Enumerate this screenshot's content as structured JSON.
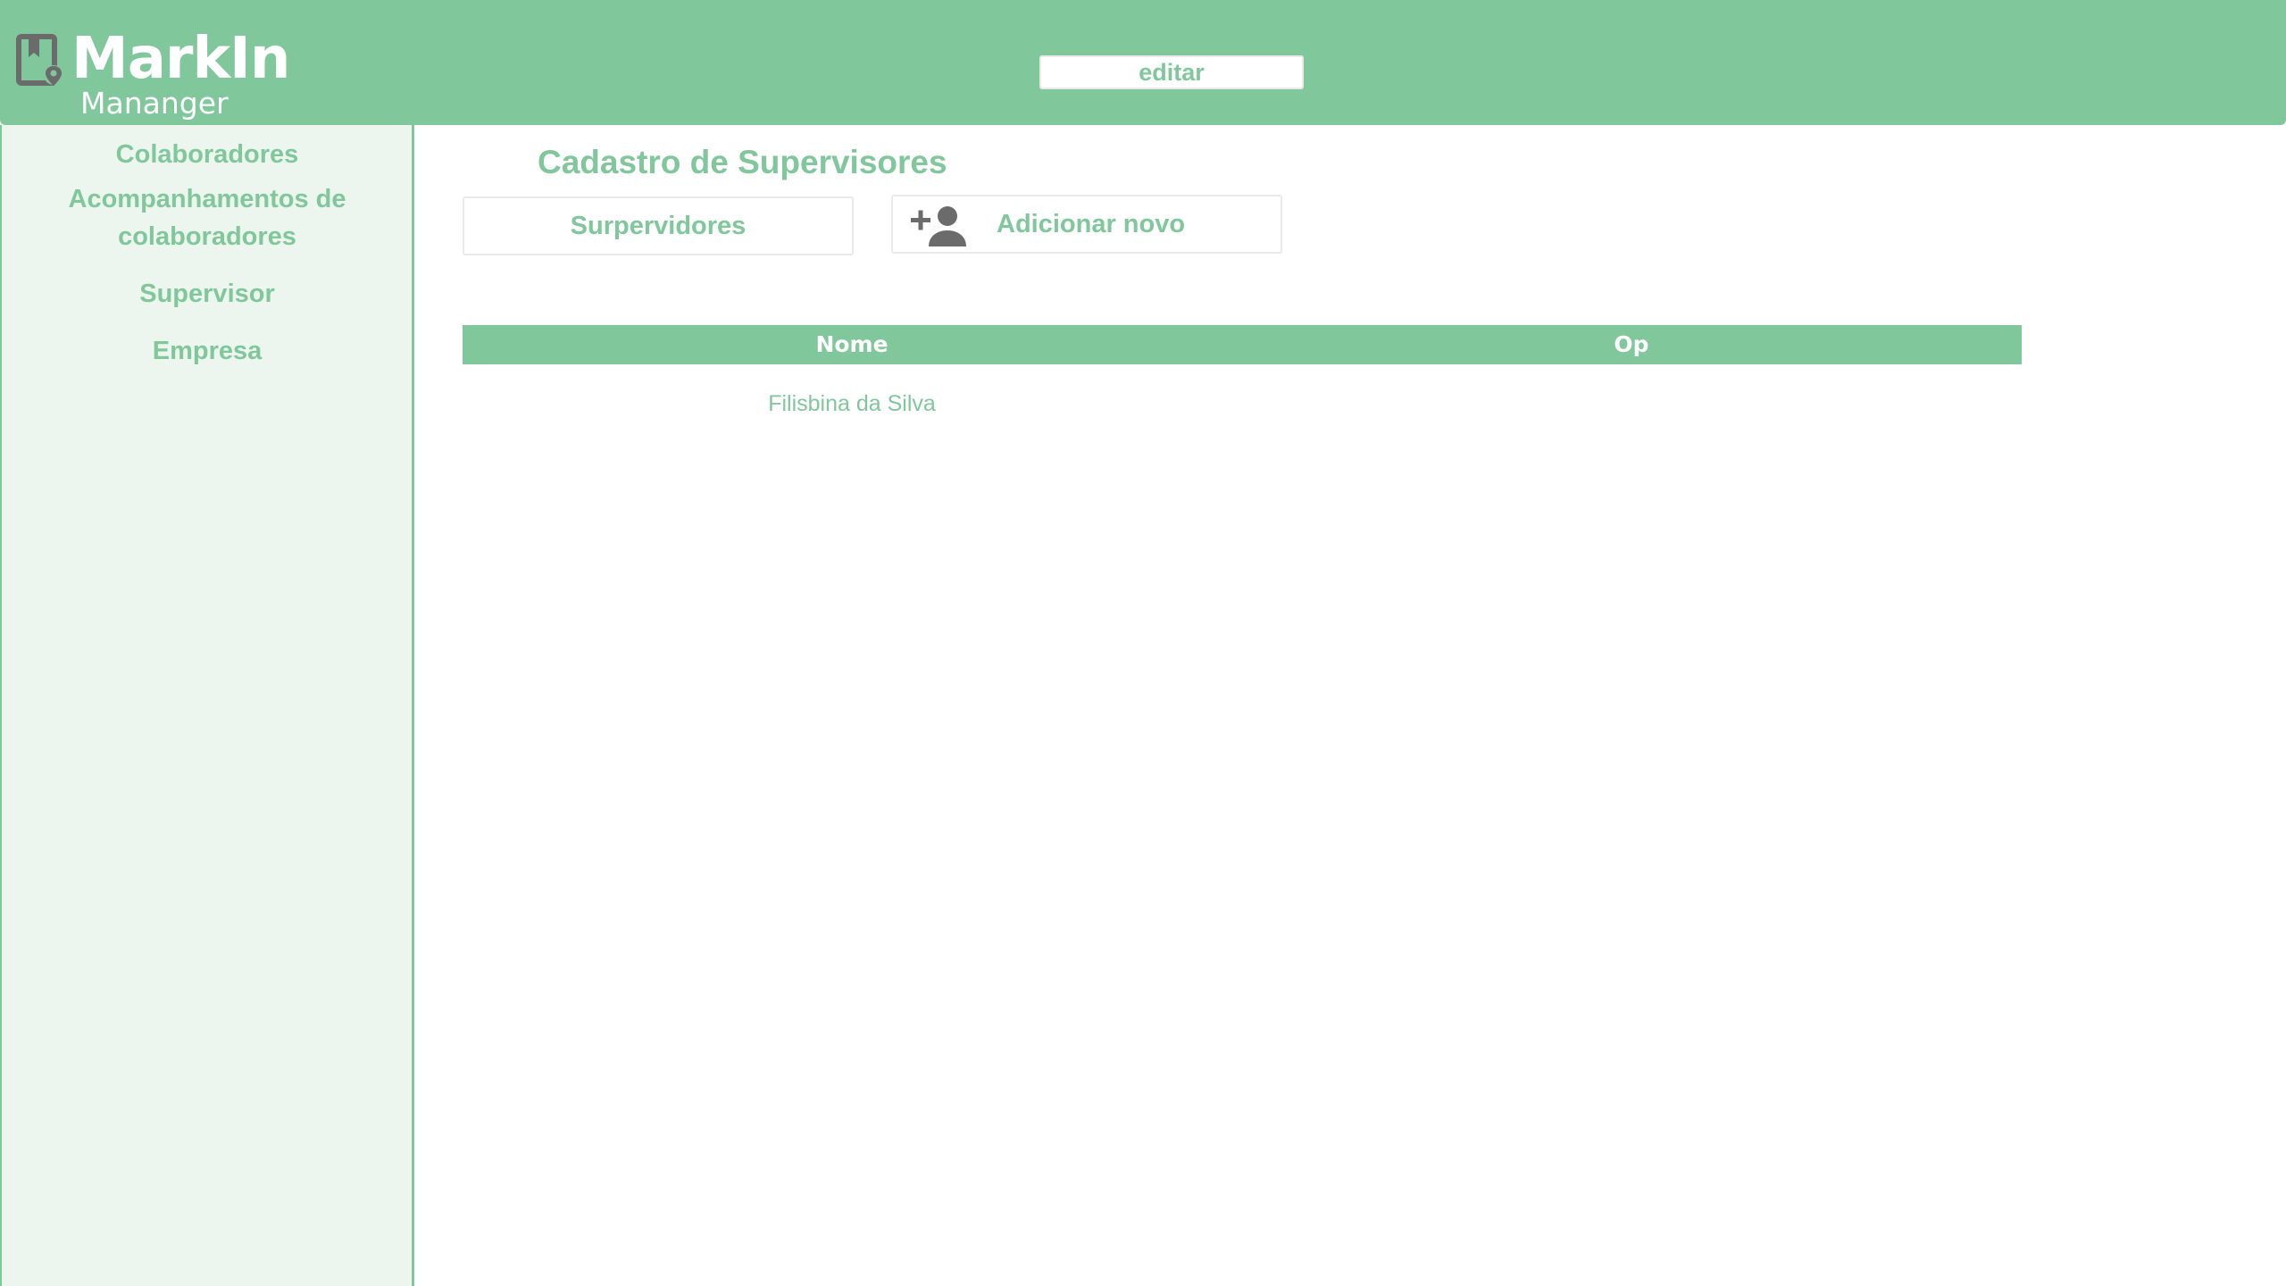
{
  "app": {
    "logo_title": "MarkIn",
    "logo_subtitle": "Mananger",
    "logo_icon": "bookmark-location-icon"
  },
  "colors": {
    "brand": "#80c79b",
    "sidebar_bg": "#ecf6ee",
    "icon_gray": "#6b6b6b"
  },
  "sidebar": {
    "items": [
      {
        "label": "Colaboradores"
      },
      {
        "label_line1": "Acompanhamentos de",
        "label_line2": "colaboradores"
      },
      {
        "label": "Supervisor"
      },
      {
        "label": "Empresa"
      }
    ]
  },
  "main": {
    "title": "Cadastro de Supervisores",
    "list_button": "Surpervidores",
    "add_button": "Adicionar novo",
    "add_icon": "add-person-icon",
    "table": {
      "headers": [
        "Nome",
        "Op"
      ],
      "rows": [
        {
          "name": "Filisbina da Silva",
          "action": "editar"
        }
      ]
    }
  }
}
